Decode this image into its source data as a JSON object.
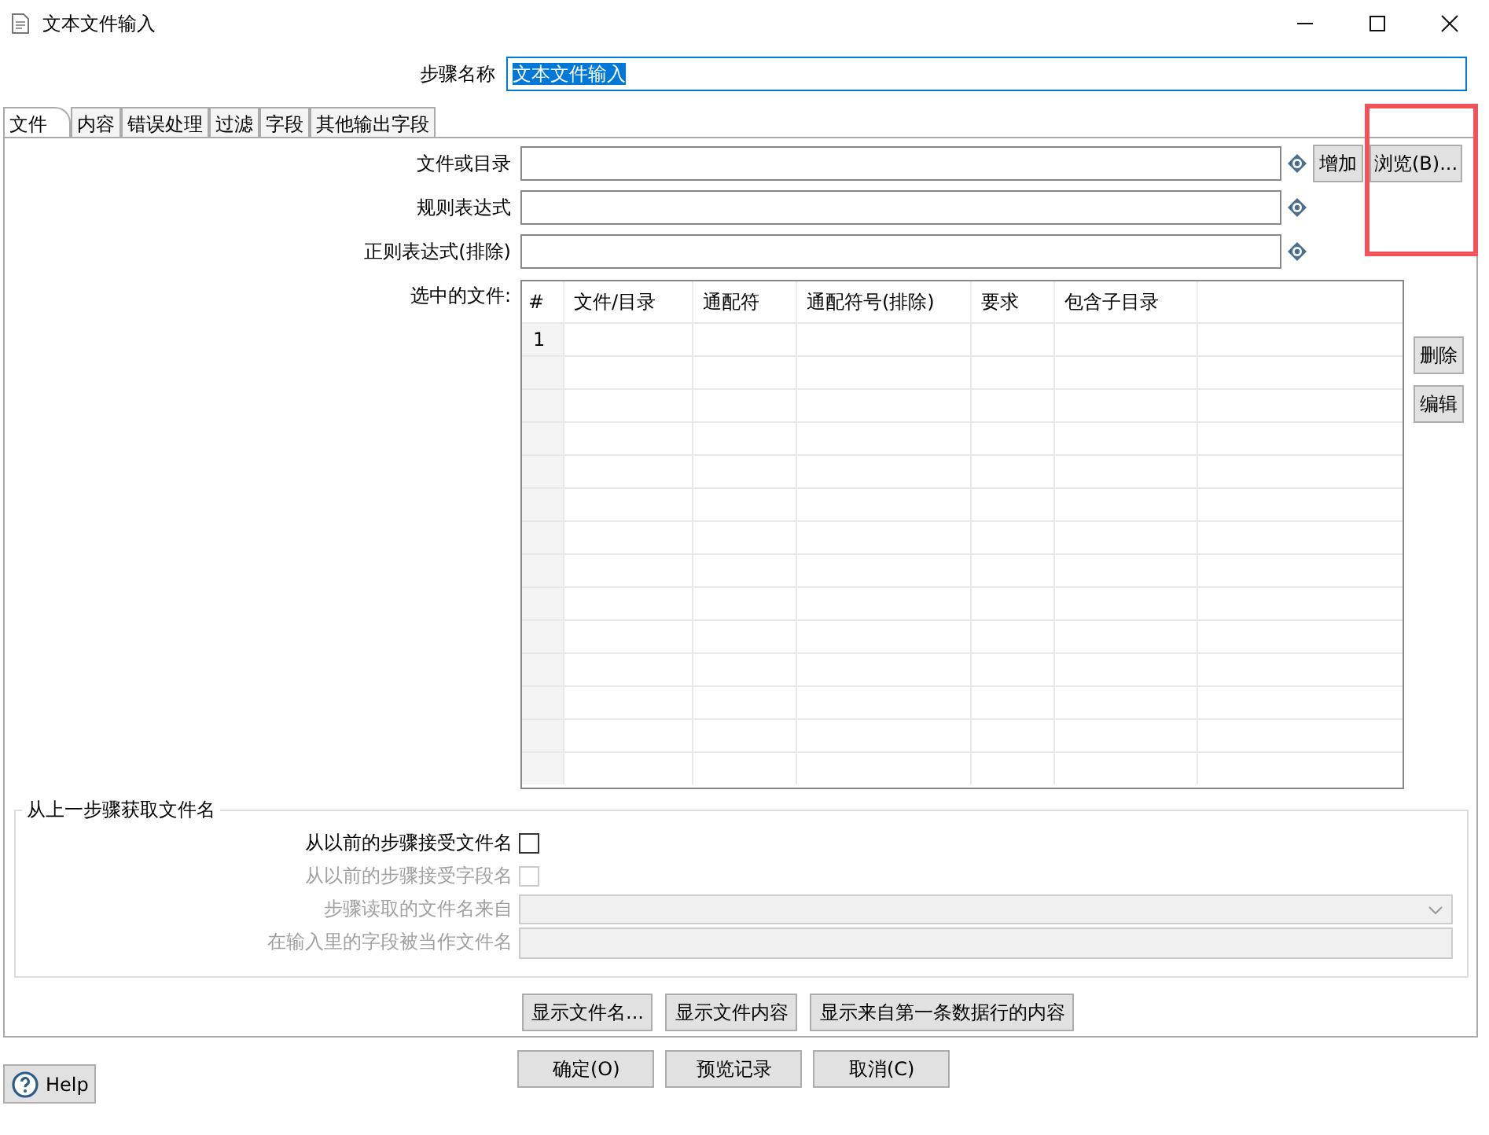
{
  "window": {
    "title": "文本文件输入"
  },
  "step_name": {
    "label": "步骤名称",
    "value": "文本文件输入",
    "text_selected": true
  },
  "tabs": [
    {
      "label": "文件",
      "selected": true
    },
    {
      "label": "内容",
      "selected": false
    },
    {
      "label": "错误处理",
      "selected": false
    },
    {
      "label": "过滤",
      "selected": false
    },
    {
      "label": "字段",
      "selected": false
    },
    {
      "label": "其他输出字段",
      "selected": false
    }
  ],
  "file_fields": [
    {
      "label": "文件或目录"
    },
    {
      "label": "规则表达式"
    },
    {
      "label": "正则表达式(排除)"
    }
  ],
  "side_buttons": [
    "增加",
    "浏览(B)..."
  ],
  "selected_files": {
    "label": "选中的文件:",
    "columns": [
      "#",
      "文件/目录",
      "通配符",
      "通配符号(排除)",
      "要求",
      "包含子目录"
    ],
    "rows": [
      {
        "number": "1"
      }
    ]
  },
  "table_buttons": [
    "删除",
    "编辑"
  ],
  "previous_step": {
    "title": "从上一步骤获取文件名",
    "rows": [
      {
        "kind": "checkbox",
        "label": "从以前的步骤接受文件名",
        "checked": false,
        "disabled": false
      },
      {
        "kind": "checkbox",
        "label": "从以前的步骤接受字段名",
        "checked": false,
        "disabled": true
      },
      {
        "kind": "dropdown",
        "label": "步骤读取的文件名来自",
        "disabled": true
      },
      {
        "kind": "text",
        "label": "在输入里的字段被当作文件名",
        "disabled": true
      }
    ]
  },
  "show_buttons": [
    "显示文件名...",
    "显示文件内容",
    "显示来自第一条数据行的内容"
  ],
  "dialog_buttons": [
    "确定(O)",
    "预览记录",
    "取消(C)"
  ],
  "help_button": {
    "label": "Help"
  },
  "annotations": [
    {
      "kind": "rectangle"
    }
  ]
}
